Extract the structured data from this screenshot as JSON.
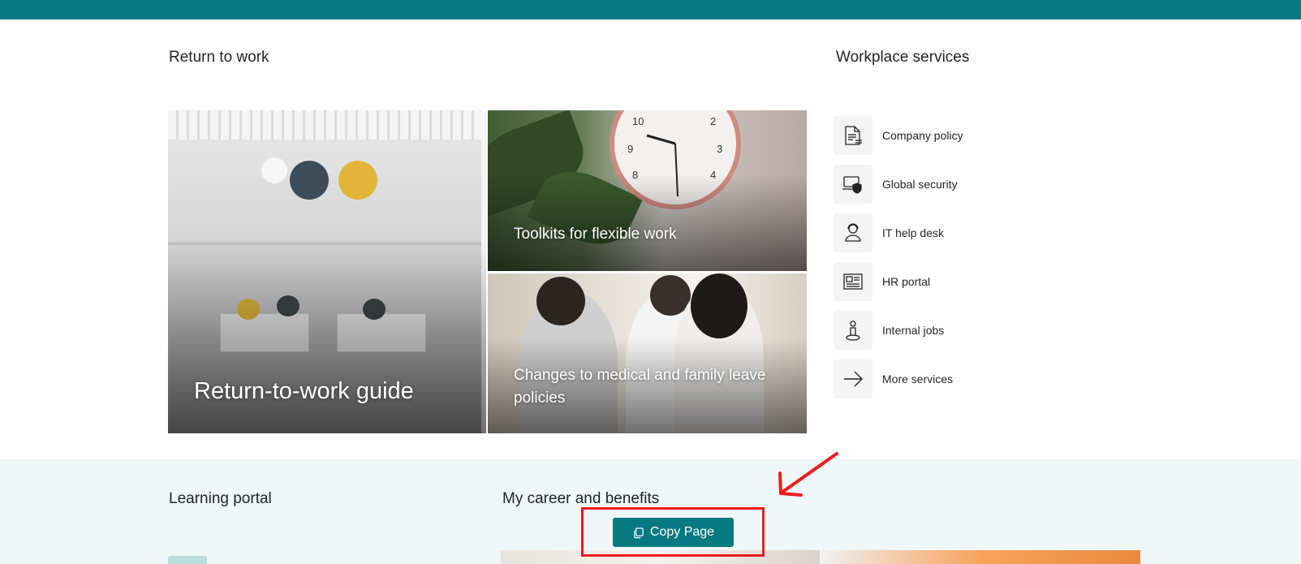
{
  "theme": {
    "accent": "#077a80",
    "annotation": "#ee1c1c"
  },
  "return_to_work": {
    "title": "Return to work",
    "tiles": [
      {
        "caption": "Return-to-work guide"
      },
      {
        "caption": "Toolkits for flexible work"
      },
      {
        "caption": "Changes to medical and family leave policies"
      }
    ]
  },
  "workplace_services": {
    "title": "Workplace services",
    "items": [
      {
        "label": "Company policy",
        "icon": "document-icon"
      },
      {
        "label": "Global security",
        "icon": "laptop-shield-icon"
      },
      {
        "label": "IT help desk",
        "icon": "headset-person-icon"
      },
      {
        "label": "HR portal",
        "icon": "news-icon"
      },
      {
        "label": "Internal jobs",
        "icon": "person-pin-icon"
      },
      {
        "label": "More services",
        "icon": "arrow-right-icon"
      }
    ]
  },
  "learning_portal": {
    "title": "Learning portal"
  },
  "career": {
    "title": "My career and benefits"
  },
  "copy_page": {
    "label": "Copy Page",
    "icon": "copy-icon"
  }
}
